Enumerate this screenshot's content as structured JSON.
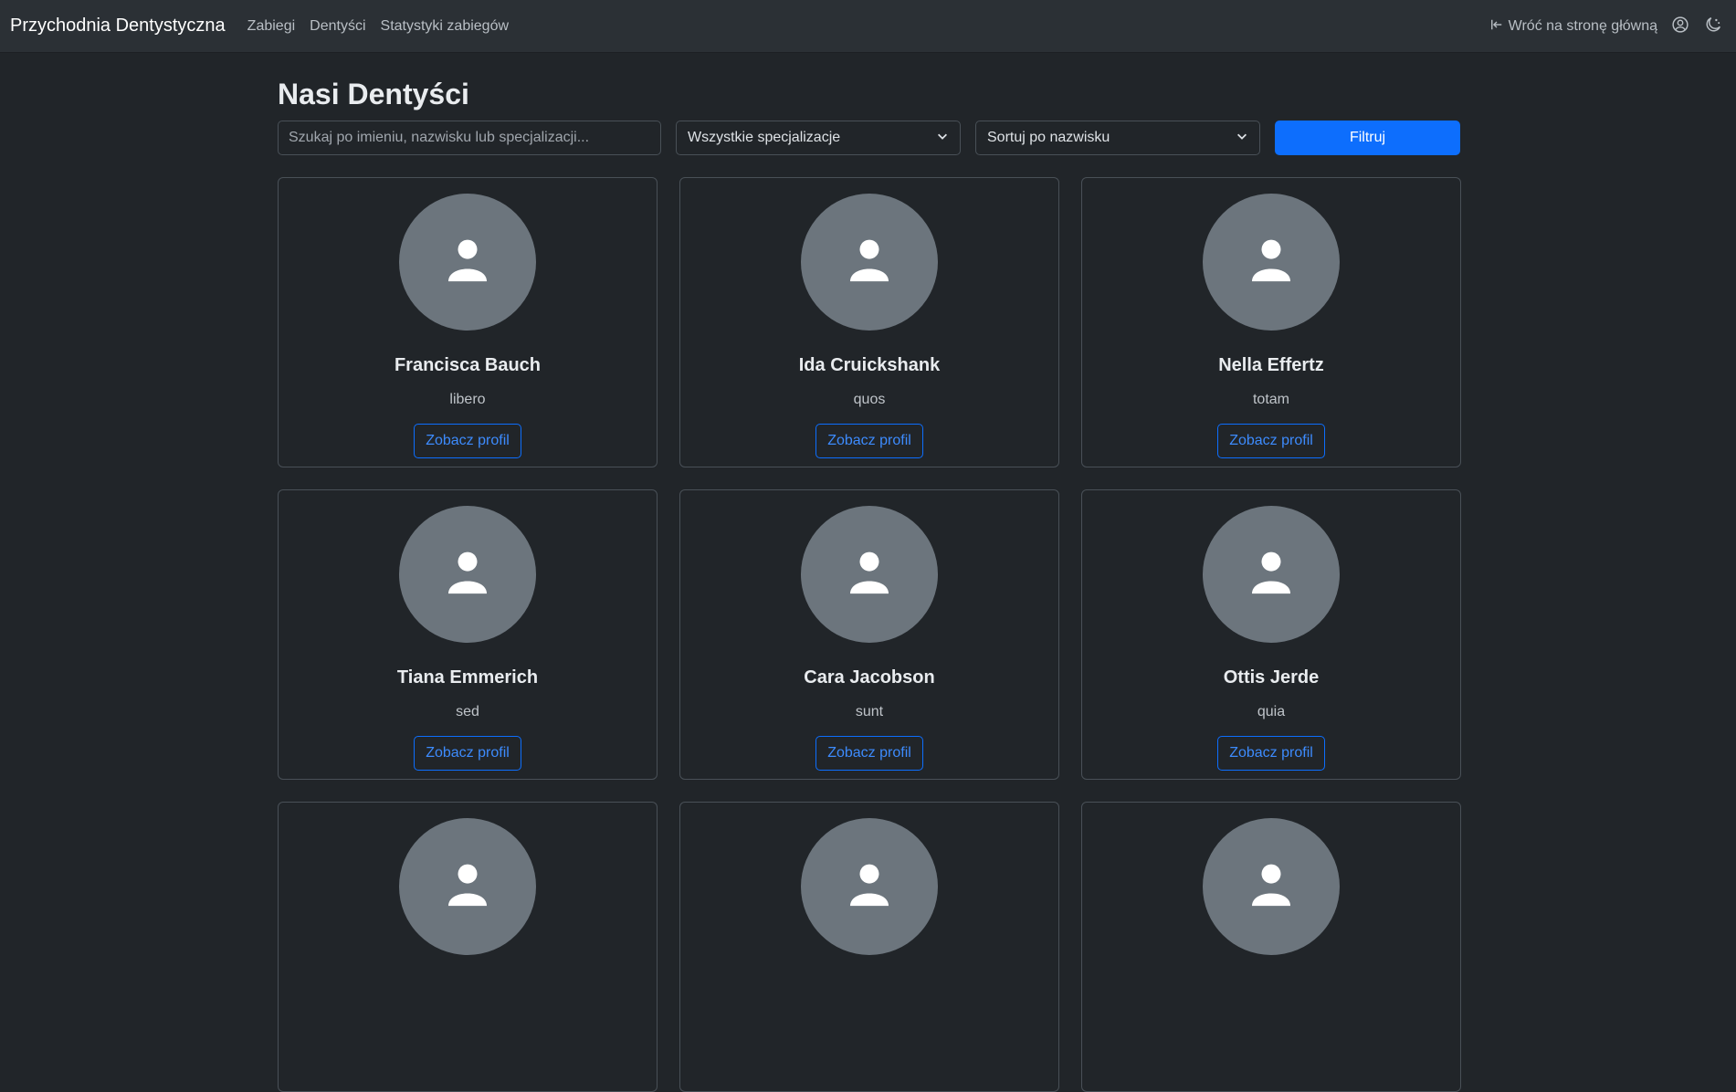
{
  "navbar": {
    "brand": "Przychodnia Dentystyczna",
    "links": [
      "Zabiegi",
      "Dentyści",
      "Statystyki zabiegów"
    ],
    "back_link": "Wróć na stronę główną",
    "icons": {
      "back": "sign-out-arrow-icon",
      "user": "user-circle-icon",
      "theme": "moon-stars-icon"
    }
  },
  "page": {
    "title": "Nasi Dentyści"
  },
  "filters": {
    "search_placeholder": "Szukaj po imieniu, nazwisku lub specjalizacji...",
    "search_value": "",
    "specialization_selected": "Wszystkie specjalizacje",
    "sort_selected": "Sortuj po nazwisku",
    "filter_button": "Filtruj"
  },
  "dentists": [
    {
      "name": "Francisca Bauch",
      "specialization": "libero",
      "button": "Zobacz profil"
    },
    {
      "name": "Ida Cruickshank",
      "specialization": "quos",
      "button": "Zobacz profil"
    },
    {
      "name": "Nella Effertz",
      "specialization": "totam",
      "button": "Zobacz profil"
    },
    {
      "name": "Tiana Emmerich",
      "specialization": "sed",
      "button": "Zobacz profil"
    },
    {
      "name": "Cara Jacobson",
      "specialization": "sunt",
      "button": "Zobacz profil"
    },
    {
      "name": "Ottis Jerde",
      "specialization": "quia",
      "button": "Zobacz profil"
    },
    {
      "name": "",
      "specialization": "",
      "button": ""
    },
    {
      "name": "",
      "specialization": "",
      "button": ""
    },
    {
      "name": "",
      "specialization": "",
      "button": ""
    }
  ],
  "colors": {
    "background": "#212529",
    "navbar": "#2b3035",
    "primary": "#0d6efd",
    "avatar": "#6c757d"
  }
}
